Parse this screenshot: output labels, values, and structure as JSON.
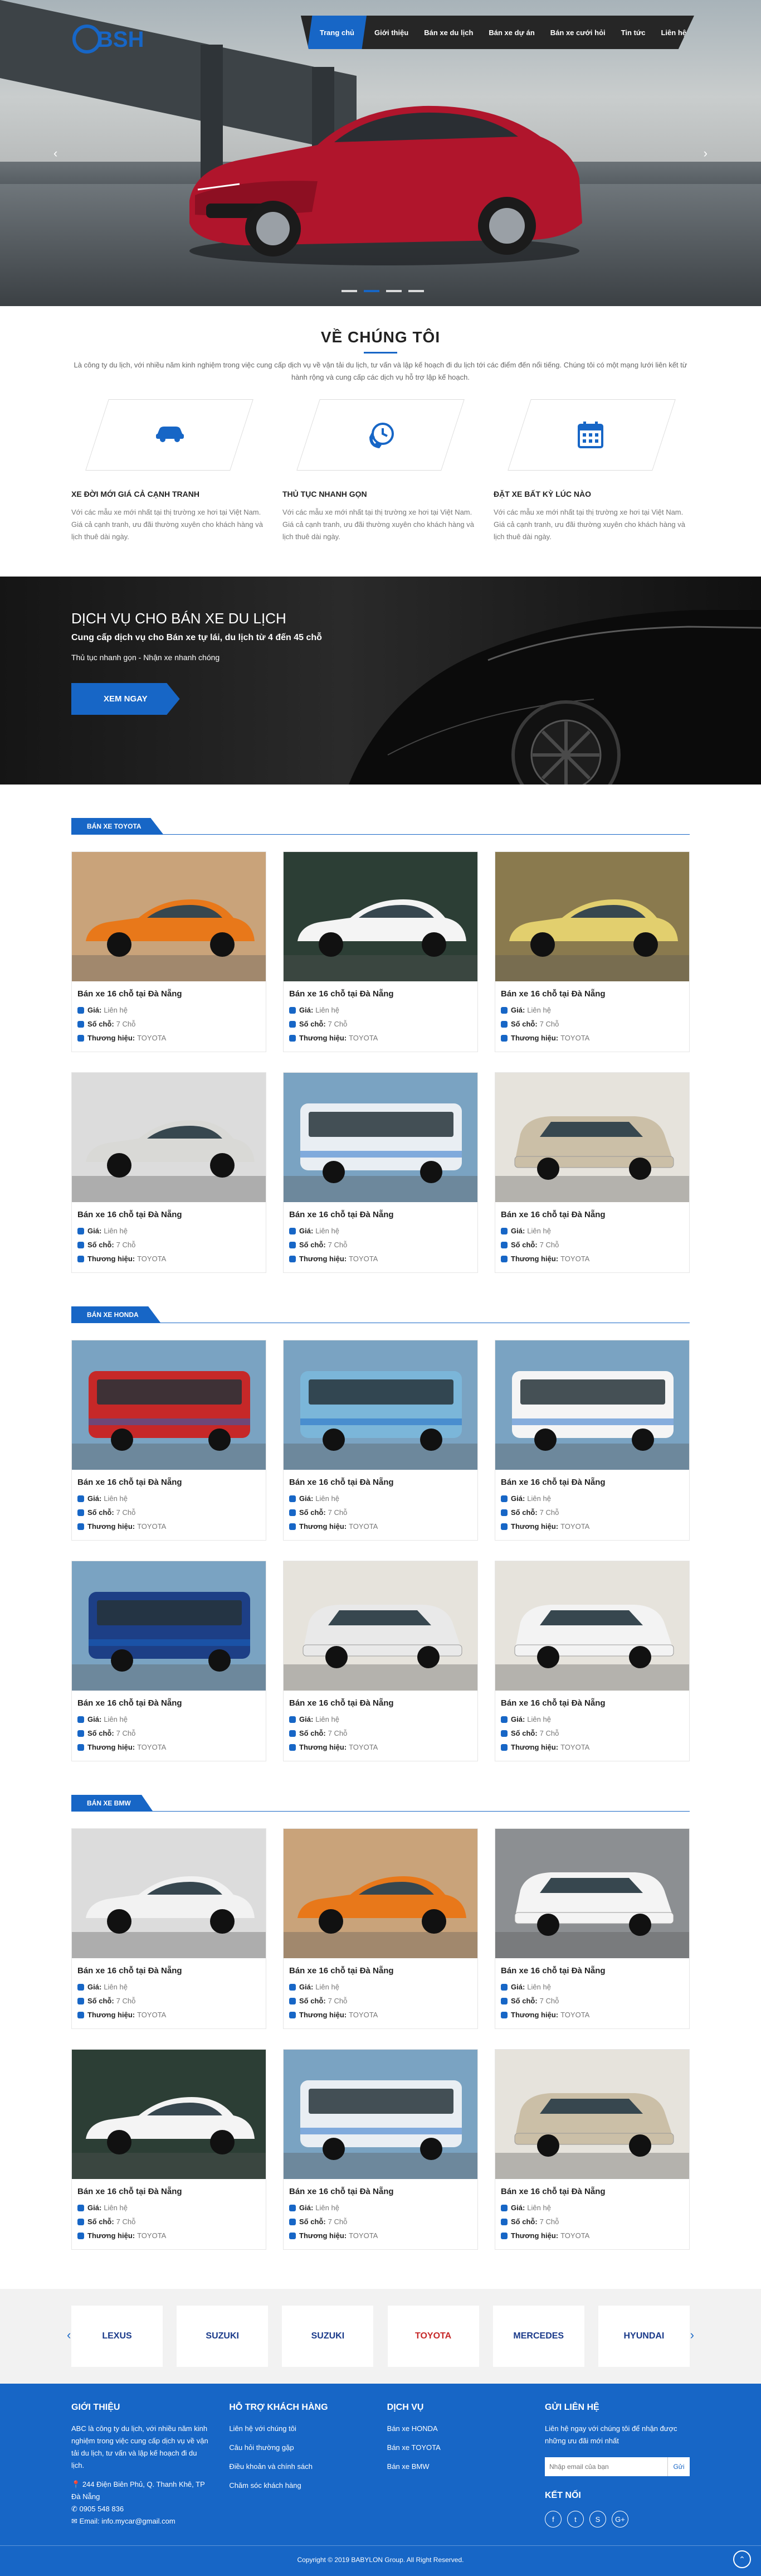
{
  "nav": [
    "Trang chủ",
    "Giới thiệu",
    "Bán xe du lịch",
    "Bán xe dự án",
    "Bán xe cưới hỏi",
    "Tin tức",
    "Liên hệ"
  ],
  "hero": {
    "logo_text": "BSH",
    "slide_count": 4,
    "active_slide": 2
  },
  "about": {
    "title": "VỀ CHÚNG TÔI",
    "intro": "Là công ty du lịch, với nhiều năm kinh nghiệm trong việc cung cấp dịch vụ về vận tải du lịch, tư vấn và lập kế hoạch đi du lịch tới các điểm đến nổi tiếng. Chúng tôi có một mạng lưới liên kết từ hành rộng và cung cấp các dịch vụ hỗ trợ lập kế hoạch.",
    "features": [
      {
        "icon": "car-icon",
        "title": "XE ĐỜI MỚI GIÁ CẢ CẠNH TRANH",
        "text": "Với các mẫu xe mới nhất tại thị trường xe hơi tại Việt Nam. Giá cả cạnh tranh, ưu đãi thường xuyên cho khách hàng và lịch thuê dài ngày."
      },
      {
        "icon": "phone-clock-icon",
        "title": "THỦ TỤC NHANH GỌN",
        "text": "Với các mẫu xe mới nhất tại thị trường xe hơi tại Việt Nam. Giá cả cạnh tranh, ưu đãi thường xuyên cho khách hàng và lịch thuê dài ngày."
      },
      {
        "icon": "calendar-icon",
        "title": "ĐẶT XE BẤT KỲ LÚC NÀO",
        "text": "Với các mẫu xe mới nhất tại thị trường xe hơi tại Việt Nam. Giá cả cạnh tranh, ưu đãi thường xuyên cho khách hàng và lịch thuê dài ngày."
      }
    ]
  },
  "service": {
    "title": "DỊCH VỤ CHO BÁN XE DU LỊCH",
    "subtitle": "Cung cấp dịch vụ cho Bán xe tự lái, du lịch từ 4 đến 45 chỗ",
    "text": "Thủ tục nhanh gọn - Nhận xe nhanh chóng",
    "button": "XEM NGAY"
  },
  "card_labels": {
    "price": "Giá:",
    "seats": "Số chỗ:",
    "brand": "Thương hiệu:"
  },
  "sections": [
    {
      "title": "BÁN XE TOYOTA",
      "cards": [
        {
          "name": "Bán xe 16 chỗ tại Đà Nẵng",
          "price": "Liên hệ",
          "seats": "7 Chỗ",
          "brand": "TOYOTA",
          "color": "#e8781a",
          "kind": "sport"
        },
        {
          "name": "Bán xe 16 chỗ tại Đà Nẵng",
          "price": "Liên hệ",
          "seats": "7 Chỗ",
          "brand": "TOYOTA",
          "color": "#f4f4f4",
          "kind": "roadster"
        },
        {
          "name": "Bán xe 16 chỗ tại Đà Nẵng",
          "price": "Liên hệ",
          "seats": "7 Chỗ",
          "brand": "TOYOTA",
          "color": "#e2cf6e",
          "kind": "classic"
        },
        {
          "name": "Bán xe 16 chỗ tại Đà Nẵng",
          "price": "Liên hệ",
          "seats": "7 Chỗ",
          "brand": "TOYOTA",
          "color": "#d9d9d6",
          "kind": "sedan"
        },
        {
          "name": "Bán xe 16 chỗ tại Đà Nẵng",
          "price": "Liên hệ",
          "seats": "7 Chỗ",
          "brand": "TOYOTA",
          "color": "#e9eef3",
          "kind": "bus"
        },
        {
          "name": "Bán xe 16 chỗ tại Đà Nẵng",
          "price": "Liên hệ",
          "seats": "7 Chỗ",
          "brand": "TOYOTA",
          "color": "#cbbfa7",
          "kind": "mpv"
        }
      ]
    },
    {
      "title": "BÁN XE HONDA",
      "cards": [
        {
          "name": "Bán xe 16 chỗ tại Đà Nẵng",
          "price": "Liên hệ",
          "seats": "7 Chỗ",
          "brand": "TOYOTA",
          "color": "#c62828",
          "kind": "bus"
        },
        {
          "name": "Bán xe 16 chỗ tại Đà Nẵng",
          "price": "Liên hệ",
          "seats": "7 Chỗ",
          "brand": "TOYOTA",
          "color": "#7bb6d9",
          "kind": "bus"
        },
        {
          "name": "Bán xe 16 chỗ tại Đà Nẵng",
          "price": "Liên hệ",
          "seats": "7 Chỗ",
          "brand": "TOYOTA",
          "color": "#f5f5f5",
          "kind": "bus"
        },
        {
          "name": "Bán xe 16 chỗ tại Đà Nẵng",
          "price": "Liên hệ",
          "seats": "7 Chỗ",
          "brand": "TOYOTA",
          "color": "#1d3f86",
          "kind": "bus"
        },
        {
          "name": "Bán xe 16 chỗ tại Đà Nẵng",
          "price": "Liên hệ",
          "seats": "7 Chỗ",
          "brand": "TOYOTA",
          "color": "#e9e9e9",
          "kind": "mpv"
        },
        {
          "name": "Bán xe 16 chỗ tại Đà Nẵng",
          "price": "Liên hệ",
          "seats": "7 Chỗ",
          "brand": "TOYOTA",
          "color": "#f3f3f3",
          "kind": "mpv"
        }
      ]
    },
    {
      "title": "BÁN XE BMW",
      "cards": [
        {
          "name": "Bán xe 16 chỗ tại Đà Nẵng",
          "price": "Liên hệ",
          "seats": "7 Chỗ",
          "brand": "TOYOTA",
          "color": "#f2f2f2",
          "kind": "sedan"
        },
        {
          "name": "Bán xe 16 chỗ tại Đà Nẵng",
          "price": "Liên hệ",
          "seats": "7 Chỗ",
          "brand": "TOYOTA",
          "color": "#e8781a",
          "kind": "sport"
        },
        {
          "name": "Bán xe 16 chỗ tại Đà Nẵng",
          "price": "Liên hệ",
          "seats": "7 Chỗ",
          "brand": "TOYOTA",
          "color": "#f4f4f4",
          "kind": "suv"
        },
        {
          "name": "Bán xe 16 chỗ tại Đà Nẵng",
          "price": "Liên hệ",
          "seats": "7 Chỗ",
          "brand": "TOYOTA",
          "color": "#f4f4f4",
          "kind": "roadster"
        },
        {
          "name": "Bán xe 16 chỗ tại Đà Nẵng",
          "price": "Liên hệ",
          "seats": "7 Chỗ",
          "brand": "TOYOTA",
          "color": "#e9eef3",
          "kind": "bus"
        },
        {
          "name": "Bán xe 16 chỗ tại Đà Nẵng",
          "price": "Liên hệ",
          "seats": "7 Chỗ",
          "brand": "TOYOTA",
          "color": "#cbbfa7",
          "kind": "mpv"
        }
      ]
    }
  ],
  "brands": [
    "LEXUS",
    "SUZUKI",
    "SUZUKI",
    "TOYOTA",
    "MERCEDES",
    "HYUNDAI"
  ],
  "footer": {
    "about_title": "GIỚI THIỆU",
    "about_text": "ABC là công ty du lịch, với nhiều năm kinh nghiệm trong việc cung cấp dịch vụ về vận tải du lịch, tư vấn và lập kế hoạch đi du lịch.",
    "address": "244 Điện Biên Phủ, Q. Thanh Khê, TP Đà Nẵng",
    "phone": "0905 548 836",
    "email": "Email: info.mycar@gmail.com",
    "support_title": "HỖ TRỢ KHÁCH HÀNG",
    "support": [
      "Liên hệ với chúng tôi",
      "Câu hỏi thường gặp",
      "Điều khoản và chính sách",
      "Chăm sóc khách hàng"
    ],
    "service_title": "DỊCH VỤ",
    "services": [
      "Bán xe HONDA",
      "Bán xe TOYOTA",
      "Bán xe BMW"
    ],
    "contact_title": "GỬI LIÊN HỆ",
    "contact_text": "Liên hệ ngay với chúng tôi để nhận được những ưu đãi mới nhất",
    "email_placeholder": "Nhập email của bạn",
    "send": "Gửi",
    "social_title": "KẾT NỐI",
    "copyright": "Copyright © 2019 BABYLON Group. All Right Reserved."
  }
}
